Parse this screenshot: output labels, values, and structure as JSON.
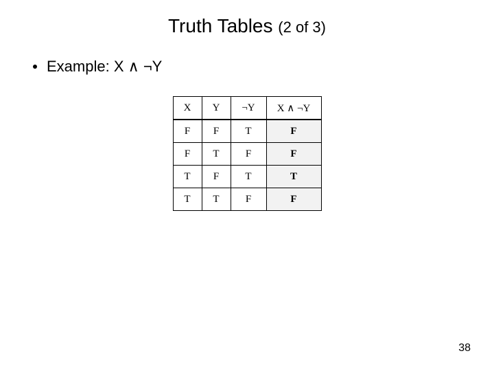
{
  "title": {
    "main": "Truth Tables ",
    "sub": "(2 of 3)"
  },
  "bullet": {
    "text": "Example: X ∧ ¬Y"
  },
  "table": {
    "headers": {
      "c0": "X",
      "c1": "Y",
      "c2": "¬Y",
      "c3": "X ∧ ¬Y"
    },
    "rows": [
      {
        "c0": "F",
        "c1": "F",
        "c2": "T",
        "c3": "F"
      },
      {
        "c0": "F",
        "c1": "T",
        "c2": "F",
        "c3": "F"
      },
      {
        "c0": "T",
        "c1": "F",
        "c2": "T",
        "c3": "T"
      },
      {
        "c0": "T",
        "c1": "T",
        "c2": "F",
        "c3": "F"
      }
    ]
  },
  "page_number": "38",
  "chart_data": {
    "type": "table",
    "title": "Truth table for X ∧ ¬Y",
    "columns": [
      "X",
      "Y",
      "¬Y",
      "X ∧ ¬Y"
    ],
    "rows": [
      [
        "F",
        "F",
        "T",
        "F"
      ],
      [
        "F",
        "T",
        "F",
        "F"
      ],
      [
        "T",
        "F",
        "T",
        "T"
      ],
      [
        "T",
        "T",
        "F",
        "F"
      ]
    ]
  }
}
